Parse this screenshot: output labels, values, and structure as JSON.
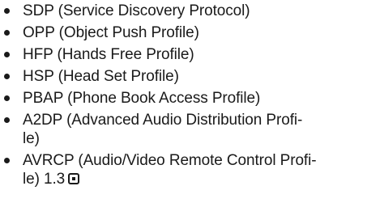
{
  "profiles": [
    "SDP (Service Discovery Protocol)",
    "OPP (Object Push Profile)",
    "HFP (Hands Free Profile)",
    "HSP (Head Set Profile)",
    "PBAP (Phone Book Access Profile)",
    {
      "line1": "A2DP (Advanced Audio Distribution Profi-",
      "line2": "le)"
    },
    {
      "line1": "AVRCP (Audio/Video Remote Control Profi-",
      "line2": "le) 1.3"
    }
  ],
  "end_mark_icon": "end-of-section-icon"
}
